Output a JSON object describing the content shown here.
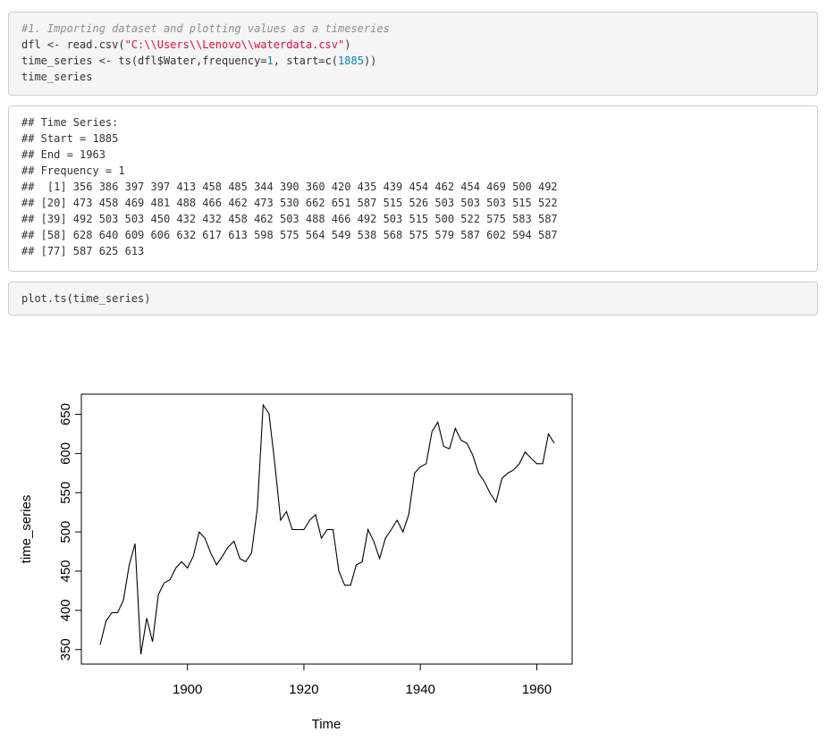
{
  "code1": {
    "comment": "#1. Importing dataset and plotting values as a timeseries",
    "line2_pre": "dfl <- read.csv(",
    "line2_str": "\"C:\\\\Users\\\\Lenovo\\\\waterdata.csv\"",
    "line2_post": ")",
    "line3_pre": "time_series <- ts(dfl$Water,frequency=",
    "line3_num1": "1",
    "line3_mid": ", start=c(",
    "line3_num2": "1885",
    "line3_post": "))",
    "line4": "time_series"
  },
  "output": {
    "lines": [
      "## Time Series:",
      "## Start = 1885",
      "## End = 1963",
      "## Frequency = 1",
      "##  [1] 356 386 397 397 413 458 485 344 390 360 420 435 439 454 462 454 469 500 492",
      "## [20] 473 458 469 481 488 466 462 473 530 662 651 587 515 526 503 503 503 515 522",
      "## [39] 492 503 503 450 432 432 458 462 503 488 466 492 503 515 500 522 575 583 587",
      "## [58] 628 640 609 606 632 617 613 598 575 564 549 538 568 575 579 587 602 594 587",
      "## [77] 587 625 613"
    ]
  },
  "code2": {
    "line": "plot.ts(time_series)"
  },
  "chart_data": {
    "type": "line",
    "xlabel": "Time",
    "ylabel": "time_series",
    "xlim": [
      1885,
      1963
    ],
    "ylim": [
      344,
      662
    ],
    "x_ticks": [
      1900,
      1920,
      1940,
      1960
    ],
    "y_ticks": [
      350,
      400,
      450,
      500,
      550,
      600,
      650
    ],
    "x_tick_labels": [
      "1900",
      "1920",
      "1940",
      "1960"
    ],
    "y_tick_labels": [
      "350",
      "400",
      "450",
      "500",
      "550",
      "600",
      "650"
    ],
    "start": 1885,
    "series": [
      {
        "values": [
          356,
          386,
          397,
          397,
          413,
          458,
          485,
          344,
          390,
          360,
          420,
          435,
          439,
          454,
          462,
          454,
          469,
          500,
          492,
          473,
          458,
          469,
          481,
          488,
          466,
          462,
          473,
          530,
          662,
          651,
          587,
          515,
          526,
          503,
          503,
          503,
          515,
          522,
          492,
          503,
          503,
          450,
          432,
          432,
          458,
          462,
          503,
          488,
          466,
          492,
          503,
          515,
          500,
          522,
          575,
          583,
          587,
          628,
          640,
          609,
          606,
          632,
          617,
          613,
          598,
          575,
          564,
          549,
          538,
          568,
          575,
          579,
          587,
          602,
          594,
          587,
          587,
          625,
          613
        ]
      }
    ],
    "grid": false,
    "line_color": "#000000"
  }
}
